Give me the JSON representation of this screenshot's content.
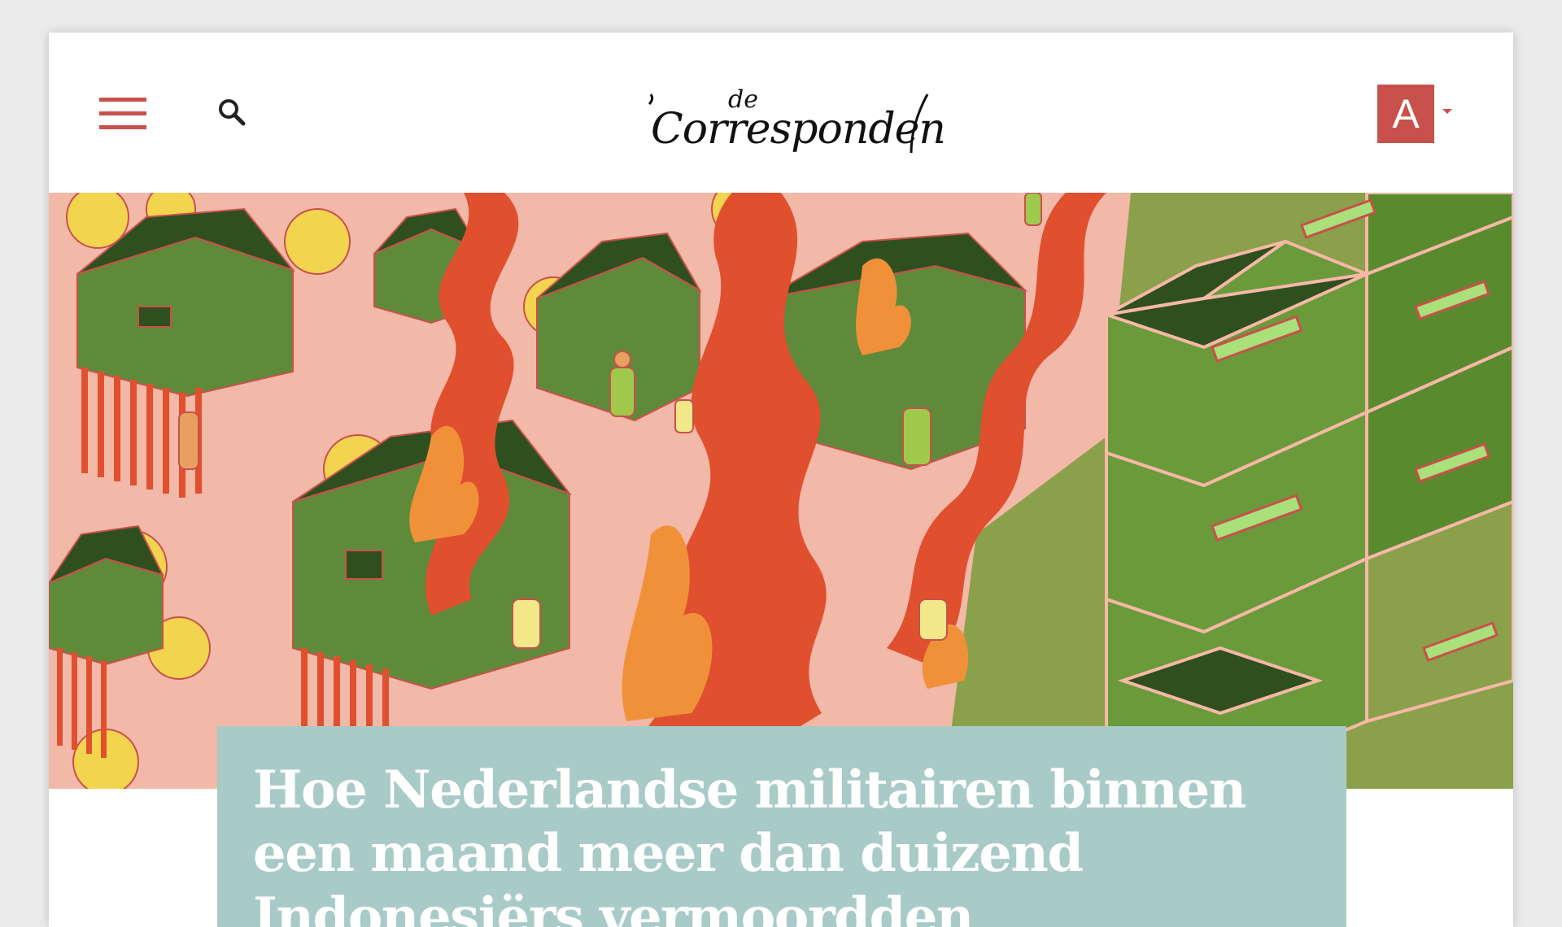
{
  "header": {
    "logo_small": "de",
    "logo_main": "Correspondent",
    "account_initial": "A"
  },
  "icons": {
    "menu": "hamburger-menu-icon",
    "search": "search-icon",
    "account_caret": "caret-down-icon"
  },
  "colors": {
    "brand_red": "#c8514b",
    "headline_box": "#a8cbc8",
    "hero_background": "#f2b8a8",
    "flame": "#e0502f",
    "house_green": "#5f8a3a",
    "roof_dark_green": "#2f4f1e",
    "cabinet_green": "#8aa04a",
    "foliage_yellow": "#f2d44e"
  },
  "article": {
    "headline": "Hoe Nederlandse militairen binnen een maand meer dan duizend Indonesiërs vermoordden"
  }
}
